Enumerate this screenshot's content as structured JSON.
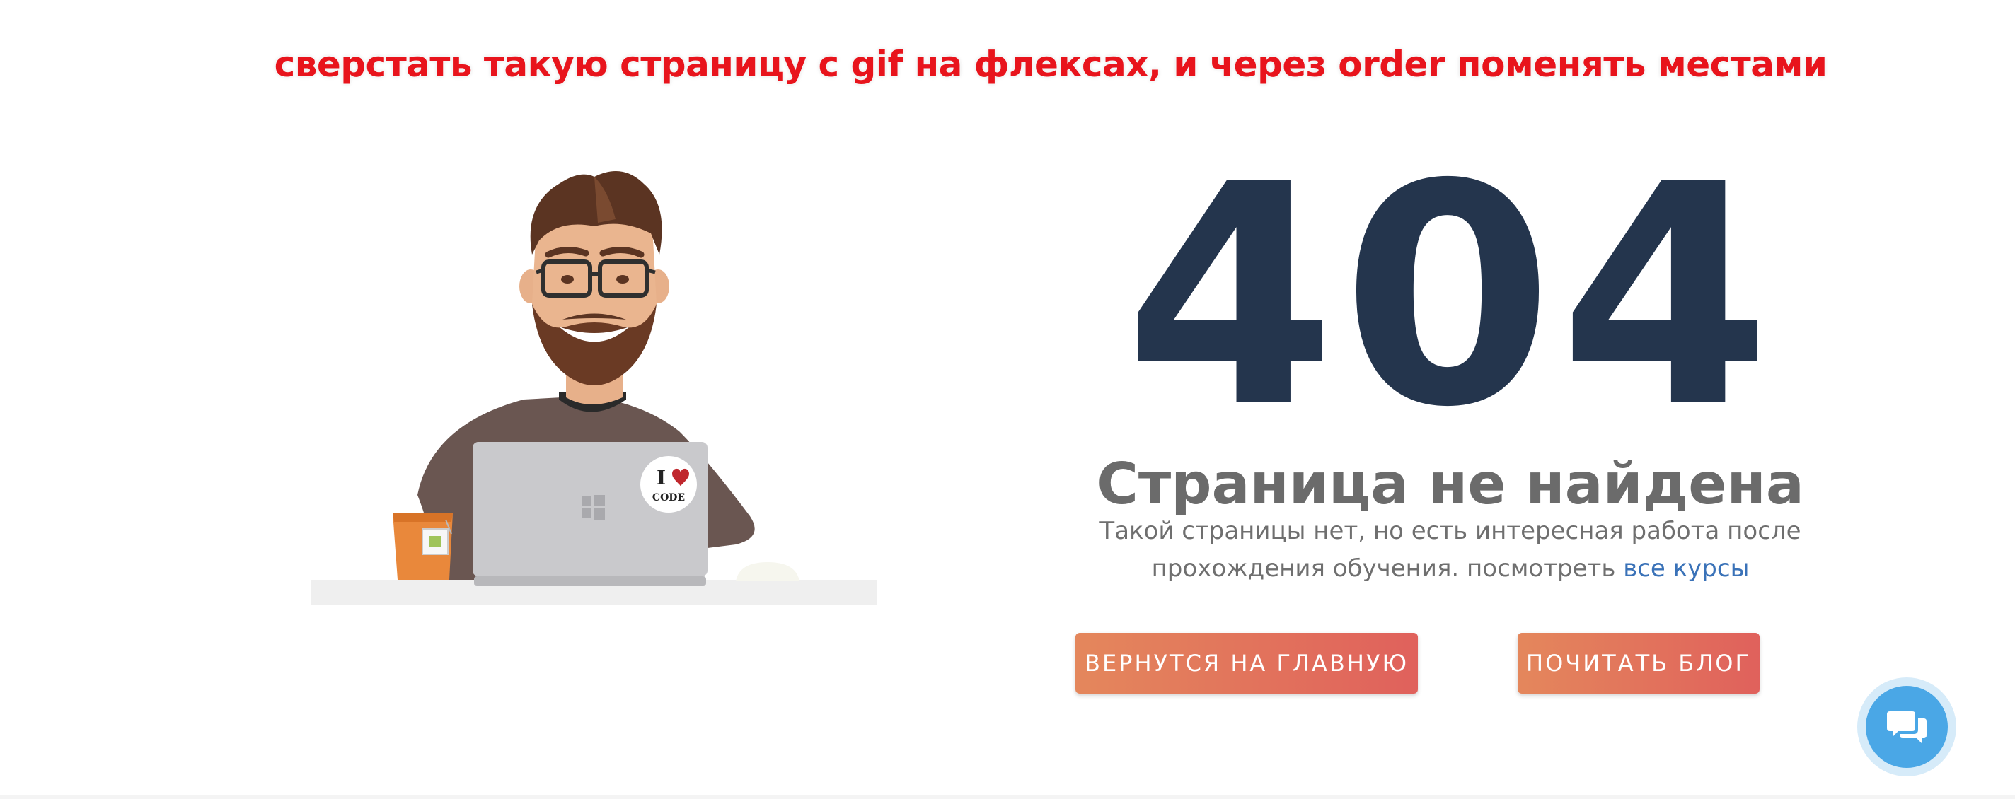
{
  "banner": {
    "text": "сверстать такую страницу с gif на флексах, и через order поменять местами"
  },
  "illustration": {
    "sticker_line1": "I",
    "sticker_line2": "CODE"
  },
  "error": {
    "code": "404",
    "title": "Страница не найдена",
    "text_before": "Такой страницы нет, но есть интересная работа после прохождения обучения. посмотреть",
    "link_label": "все курсы"
  },
  "buttons": {
    "home_label": "ВЕРНУТСЯ НА ГЛАВНУЮ",
    "blog_label": "ПОЧИТАТЬ БЛОГ"
  },
  "icons": {
    "chat": "chat-bubbles-icon"
  },
  "colors": {
    "banner": "#e8141c",
    "code": "#24354d",
    "title": "#6b6b6b",
    "link": "#3a72b8",
    "button_start": "#e4875c",
    "button_end": "#e0615c",
    "chat": "#4aa7e6"
  }
}
